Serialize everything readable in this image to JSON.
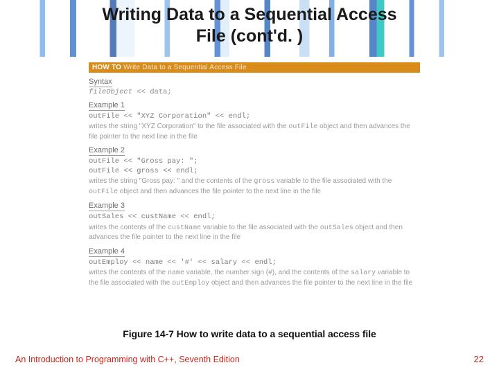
{
  "title_line1": "Writing Data to a Sequential Access",
  "title_line2": "File (cont'd. )",
  "howto": {
    "label": "HOW TO",
    "title": "Write Data to a Sequential Access File"
  },
  "syntax": {
    "head": "Syntax",
    "line_obj": "fileObject",
    "line_rest": " << data;"
  },
  "ex1": {
    "head": "Example 1",
    "code": "outFile << \"XYZ Corporation\" << endl;",
    "desc_a": "writes the string \"XYZ Corporation\" to the file associated with the ",
    "desc_mono": "outFile",
    "desc_b": " object and then advances the file pointer to the next line in the file"
  },
  "ex2": {
    "head": "Example 2",
    "code1": "outFile << \"Gross pay: \";",
    "code2": "outFile << gross << endl;",
    "desc_a": "writes the string \"Gross pay: \" and the contents of the ",
    "desc_m1": "gross",
    "desc_b": " variable to the file associated with the ",
    "desc_m2": "outFile",
    "desc_c": " object and then advances the file pointer to the next line in the file"
  },
  "ex3": {
    "head": "Example 3",
    "code": "outSales << custName << endl;",
    "desc_a": "writes the contents of the ",
    "desc_m1": "custName",
    "desc_b": " variable to the file associated with the ",
    "desc_m2": "outSales",
    "desc_c": " object and then advances the file pointer to the next line in the file"
  },
  "ex4": {
    "head": "Example 4",
    "code": "outEmploy << name << '#' << salary << endl;",
    "desc_a": "writes the contents of the ",
    "desc_m1": "name",
    "desc_b": " variable, the number sign (#), and the contents of the ",
    "desc_m2": "salary",
    "desc_c": " variable to the file associated with the ",
    "desc_m3": "outEmploy",
    "desc_d": " object and then advances the file pointer to the next line in the file"
  },
  "caption": "Figure 14-7 How to write data to a sequential access file",
  "footer": "An Introduction to Programming with C++, Seventh Edition",
  "pagenum": "22"
}
